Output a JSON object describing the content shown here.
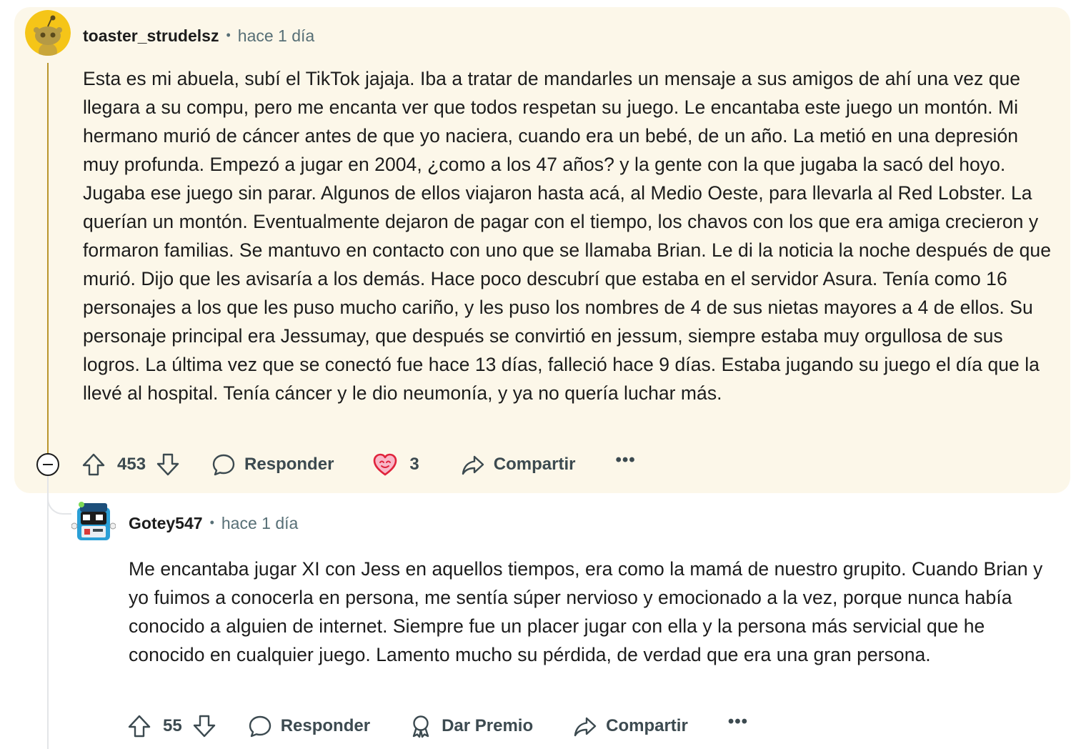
{
  "parent_comment": {
    "username": "toaster_strudelsz",
    "separator": "•",
    "time": "hace 1 día",
    "body": "Esta es mi abuela, subí el TikTok jajaja. Iba a tratar de mandarles un mensaje a sus amigos de ahí una vez que llegara a su compu, pero me encanta ver que todos respetan su juego. Le encantaba este juego un montón. Mi hermano murió de cáncer antes de que yo naciera, cuando era un bebé, de un año. La metió en una depresión muy profunda. Empezó a jugar en 2004, ¿como a los 47 años? y la gente con la que jugaba la sacó del hoyo. Jugaba ese juego sin parar. Algunos de ellos viajaron hasta acá, al Medio Oeste, para llevarla al Red Lobster. La querían un montón. Eventualmente dejaron de pagar con el tiempo, los chavos con los que era amiga crecieron y formaron familias. Se mantuvo en contacto con uno que se llamaba Brian. Le di la noticia la noche después de que murió. Dijo que les avisaría a los demás. Hace poco descubrí que estaba en el servidor Asura. Tenía como 16 personajes a los que les puso mucho cariño, y les puso los nombres de 4 de sus nietas mayores a 4 de ellos. Su personaje principal era Jessumay, que después se convirtió en jessum, siempre estaba muy orgullosa de sus logros. La última vez que se conectó fue hace 13 días, falleció hace 9 días. Estaba jugando su juego el día que la llevé al hospital. Tenía cáncer y le dio neumonía, y ya no quería luchar más.",
    "votes": "453",
    "reply_label": "Responder",
    "award_count": "3",
    "share_label": "Compartir",
    "more_label": "•••"
  },
  "reply_comment": {
    "username": "Gotey547",
    "separator": "•",
    "time": "hace 1 día",
    "body": "Me encantaba jugar XI con Jess en aquellos tiempos, era como la mamá de nuestro grupito. Cuando Brian y yo fuimos a conocerla en persona, me sentía súper nervioso y emocionado a la vez, porque nunca había conocido a alguien de internet. Siempre fue un placer jugar con ella y la persona más servicial que he conocido en cualquier juego. Lamento mucho su pérdida, de verdad que era una gran persona.",
    "votes": "55",
    "reply_label": "Responder",
    "award_label": "Dar Premio",
    "share_label": "Compartir",
    "more_label": "•••"
  },
  "colors": {
    "highlight_bg": "#fcf7e9",
    "thread_accent": "#b9962d",
    "text": "#1c1c1c",
    "meta": "#576f76",
    "action": "#3c4a50"
  },
  "icons": {
    "upvote": "upvote-arrow-icon",
    "downvote": "downvote-arrow-icon",
    "reply": "speech-bubble-icon",
    "award": "heart-award-icon",
    "give_award": "award-ribbon-icon",
    "share": "share-arrow-icon",
    "collapse": "collapse-minus-icon"
  }
}
